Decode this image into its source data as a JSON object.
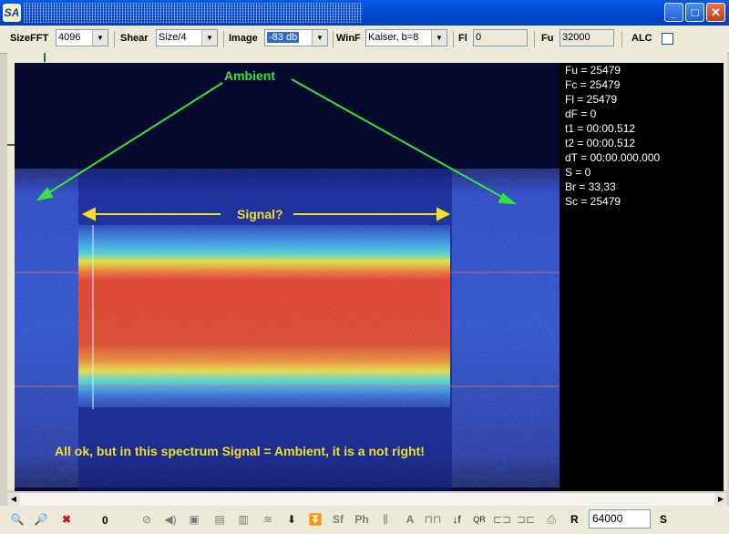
{
  "window": {
    "icon": "SA",
    "min": "_",
    "max": "□",
    "close": "✕"
  },
  "toolbar": {
    "sizefft_label": "SizeFFT",
    "sizefft_value": "4096",
    "shear_label": "Shear",
    "shear_value": "Size/4",
    "image_label": "Image",
    "image_value": "-83 db",
    "winf_label": "WinF",
    "winf_value": "Kaiser, b=8",
    "fl_label": "Fl",
    "fl_value": "0",
    "fu_label": "Fu",
    "fu_value": "32000",
    "alc_label": "ALC"
  },
  "spectrum": {
    "ambient_label": "Ambient",
    "signal_label": "Signal?",
    "caption": "All ok, but in this spectrum Signal = Ambient, it is a not right!"
  },
  "readout": [
    "Fu = 25479",
    "Fc = 25479",
    "Fl = 25479",
    "dF = 0",
    "t1 = 00:00.512",
    "t2 = 00:00.512",
    "dT = 00:00.000.000",
    "S = 0",
    "Br = 33,33",
    "Sc = 25479"
  ],
  "bottombar": {
    "counter": "0",
    "r_label": "R",
    "r_value": "64000",
    "s_label": "S"
  },
  "colors": {
    "annotation_green": "#34e43a",
    "annotation_yellow": "#f3df25"
  }
}
